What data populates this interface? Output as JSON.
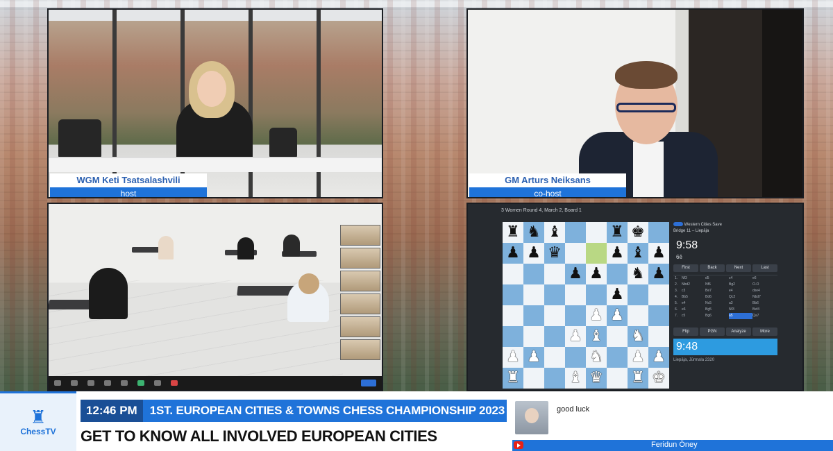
{
  "host": {
    "name": "WGM Keti Tsatsalashvili",
    "role": "host"
  },
  "cohost": {
    "name": "GM Arturs Neiksans",
    "role": "co-host"
  },
  "chess": {
    "round_label": "3 Women Round 4, March 2, Board 1",
    "header_line1": "Western Cities Save",
    "header_line2": "Bridge 11 – Liepāja",
    "clock_top": "9:58",
    "move_indicator": "6ê",
    "nav": [
      "First",
      "Back",
      "Next",
      "Last"
    ],
    "actions": [
      "Flip",
      "PGN",
      "Analyze",
      "More"
    ],
    "clock_bottom": "9:48",
    "footer": "Liepāja, Jūrmala   2320",
    "board": [
      [
        "bR",
        "bN",
        "bB",
        "",
        "",
        "bR",
        "bK",
        ""
      ],
      [
        "bP",
        "bP",
        "bQ",
        "",
        "",
        "bP",
        "bB",
        "bP"
      ],
      [
        "",
        "",
        "",
        "bP",
        "bP",
        "",
        "bN",
        "bP"
      ],
      [
        "",
        "",
        "",
        "",
        "",
        "bP",
        "",
        ""
      ],
      [
        "",
        "",
        "",
        "",
        "wP",
        "wP",
        "",
        ""
      ],
      [
        "",
        "",
        "",
        "wP",
        "wB",
        "",
        "wN",
        ""
      ],
      [
        "wP",
        "wP",
        "",
        "",
        "wN",
        "",
        "wP",
        "wP"
      ],
      [
        "wR",
        "",
        "",
        "wB",
        "wQ",
        "",
        "wR",
        "wK"
      ]
    ],
    "highlight": [
      [
        1,
        4
      ]
    ],
    "moves": [
      [
        "1.",
        "Nf3",
        "d5",
        "c4",
        "e6"
      ],
      [
        "2.",
        "Nbd2",
        "Nf6",
        "Bg2",
        "O-O"
      ],
      [
        "3.",
        "c3",
        "Be7",
        "e4",
        "dxe4"
      ],
      [
        "4.",
        "Bb5",
        "Bd6",
        "Qc2",
        "Nbd7"
      ],
      [
        "5.",
        "e4",
        "Nc5",
        "a3",
        "Bb6"
      ],
      [
        "6.",
        "e6",
        "Bg5",
        "Nf3",
        "Bxf4"
      ],
      [
        "7.",
        "c5",
        "Bg6",
        "a5",
        "Qa7"
      ]
    ],
    "active_move": 6
  },
  "lower_third": {
    "time": "12:46 PM",
    "headline": "1ST. EUROPEAN CITIES & TOWNS CHESS CHAMPIONSHIP 2023",
    "subline": "GET TO KNOW ALL INVOLVED EUROPEAN CITIES",
    "brand": "ChessTV",
    "chat_message": "good luck",
    "chat_author": "Feridun Öney"
  },
  "colors": {
    "accent": "#1f73d9",
    "board_dark": "#7eb1dc",
    "board_light": "#f0f4f8"
  }
}
